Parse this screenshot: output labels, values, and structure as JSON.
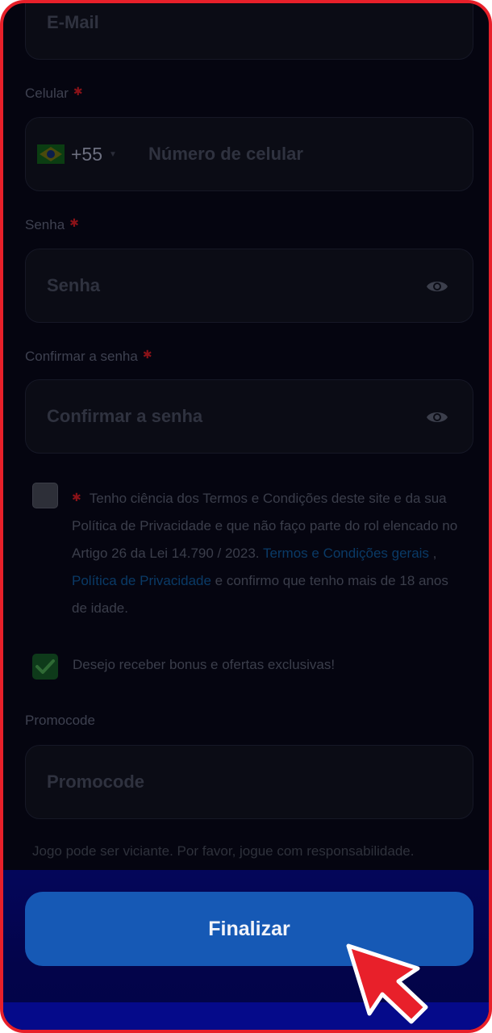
{
  "form": {
    "email": {
      "placeholder": "E-Mail"
    },
    "celular": {
      "label": "Celular",
      "dial_code": "+55",
      "placeholder": "Número de celular"
    },
    "senha": {
      "label": "Senha",
      "placeholder": "Senha"
    },
    "confirmar": {
      "label": "Confirmar a senha",
      "placeholder": "Confirmar a senha"
    },
    "terms": {
      "checked": false,
      "text_before": "Tenho ciência dos Termos e Condições deste site e da sua Política de Privacidade e que não faço parte do rol elencado no Artigo 26 da Lei 14.790 / 2023.",
      "link_terms": "Termos e Condições gerais",
      "separator": " , ",
      "link_privacy": "Política de Privacidade",
      "text_after": "e confirmo que tenho mais de 18 anos de idade."
    },
    "bonus": {
      "checked": true,
      "label": "Desejo receber bonus e ofertas exclusivas!"
    },
    "promocode": {
      "label": "Promocode",
      "placeholder": "Promocode"
    },
    "responsible_notice": "Jogo pode ser viciante. Por favor, jogue com responsabilidade.",
    "required_marker": "✱",
    "submit_label": "Finalizar"
  },
  "colors": {
    "accent": "#1659b5",
    "frame_border": "#e8202a",
    "required": "#8a1218",
    "link": "#0a3a66"
  },
  "icons": [
    "brazil-flag-icon",
    "eye-icon",
    "check-icon",
    "pointer-arrow-icon"
  ]
}
